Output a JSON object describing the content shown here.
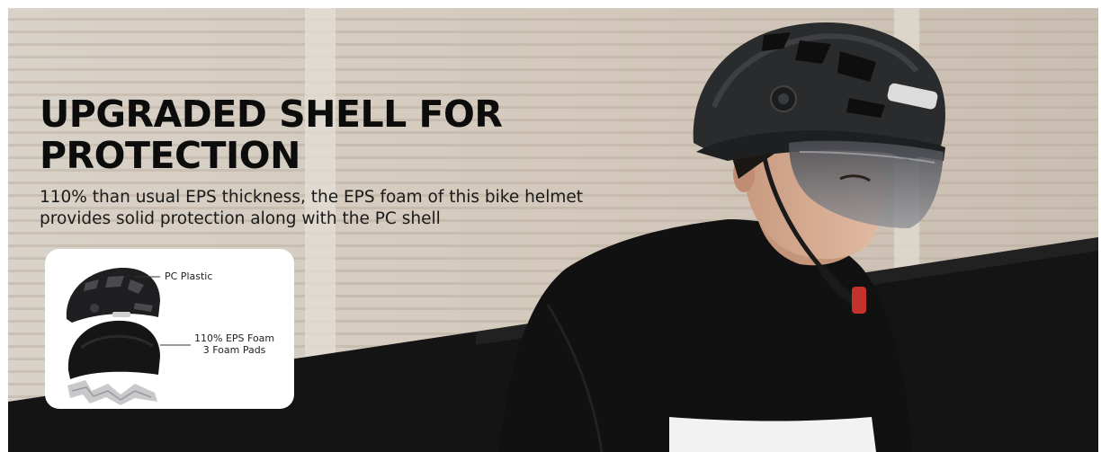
{
  "hero": {
    "headline": "UPGRADED SHELL FOR PROTECTION",
    "subtext": "110% than usual EPS thickness, the EPS foam of this bike helmet provides solid protection along with the PC shell"
  },
  "layers_inset": {
    "shell_label": "PC Plastic",
    "foam_label_line1": "110% EPS Foam",
    "foam_label_line2": "3 Foam Pads"
  },
  "colors": {
    "headline": "#0c0c0c",
    "body_text": "#1a1a1a",
    "helmet": "#2a2b2d",
    "shirt": "#111111",
    "wall": "#d8cfc4"
  }
}
